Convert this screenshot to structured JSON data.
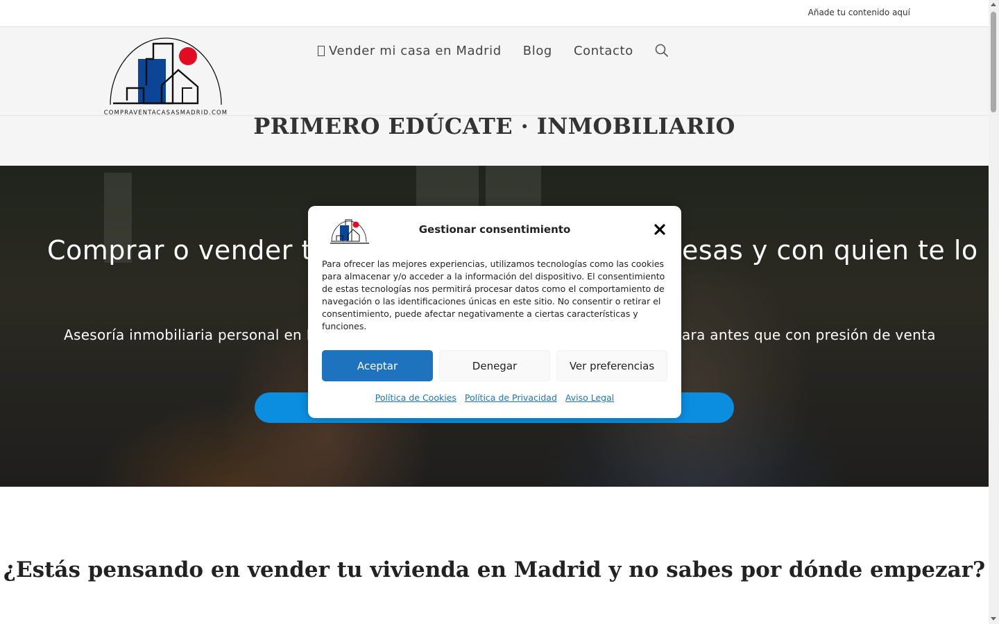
{
  "topbar": {
    "text": "Añade tu contenido aquí"
  },
  "header": {
    "logo_text": "COMPRAVENTACASASMADRID.COM",
    "nav": [
      {
        "label": "Vender mi casa en Madrid",
        "icon": "missing-glyph-icon"
      },
      {
        "label": "Blog"
      },
      {
        "label": "Contacto"
      }
    ],
    "search_icon": "search-icon"
  },
  "page_title": "PRIMERO EDÚCATE · INMOBILIARIO",
  "hero": {
    "heading_left": "Comprar o vender tu",
    "heading_right": "esas y con quien te lo",
    "sub_left": "Asesoría inmobiliaria personal en M",
    "sub_right": "ara antes que con presión de venta"
  },
  "consent": {
    "title": "Gestionar consentimiento",
    "body": "Para ofrecer las mejores experiencias, utilizamos tecnologías como las cookies para almacenar y/o acceder a la información del dispositivo. El consentimiento de estas tecnologías nos permitirá procesar datos como el comportamiento de navegación o las identificaciones únicas en este sitio. No consentir o retirar el consentimiento, puede afectar negativamente a ciertas características y funciones.",
    "accept_label": "Aceptar",
    "deny_label": "Denegar",
    "prefs_label": "Ver preferencias",
    "links": [
      "Política de Cookies",
      "Política de Privacidad",
      "Aviso Legal"
    ],
    "accent_color": "#1e73be"
  },
  "section": {
    "heading": "¿Estás pensando en vender tu vivienda en Madrid y no sabes por dónde empezar?"
  },
  "colors": {
    "hero_button": "#0b8de0",
    "logo_blue": "#0d4596",
    "logo_red": "#e00d23"
  }
}
